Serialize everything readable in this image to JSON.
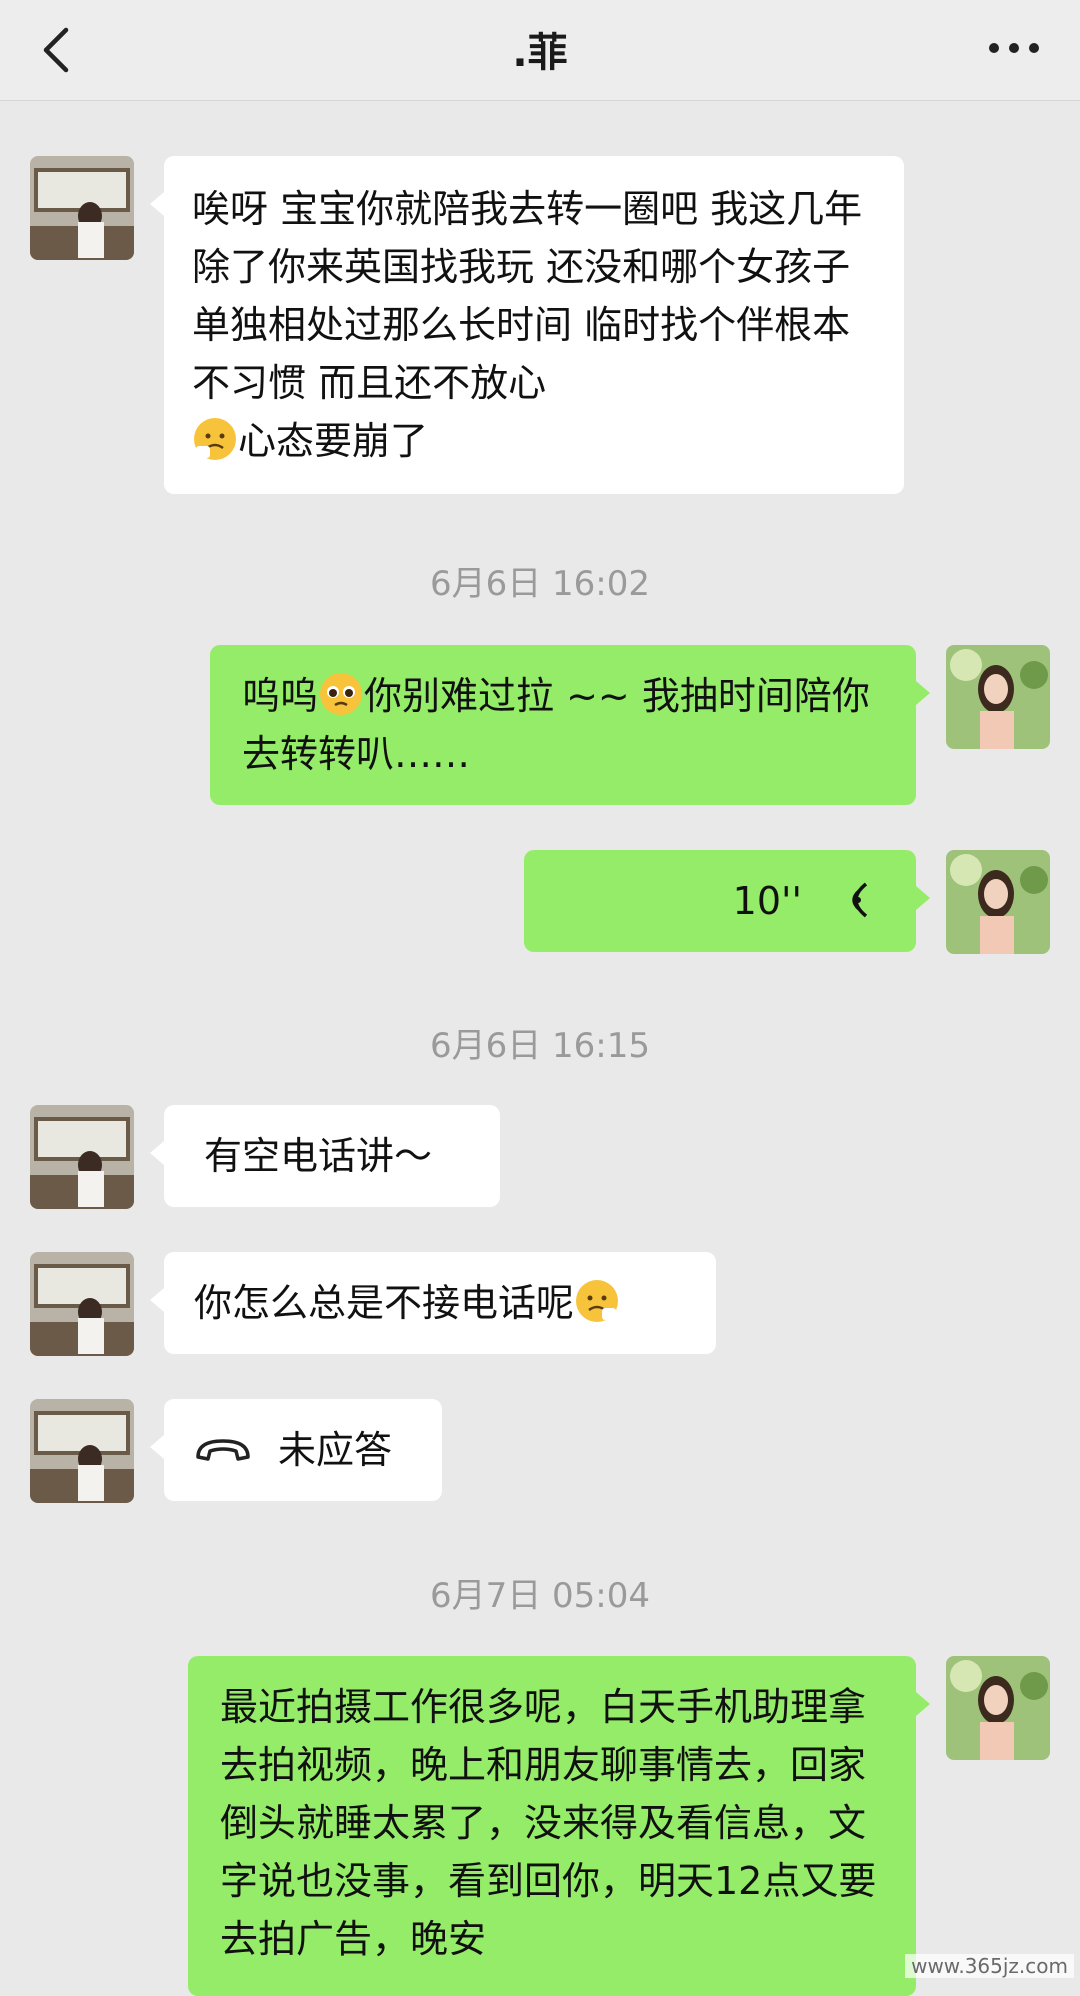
{
  "header": {
    "title": ".菲"
  },
  "messages": {
    "m1": "唉呀 宝宝你就陪我去转一圈吧 我这几年除了你来英国找我玩 还没和哪个女孩子单独相处过那么长时间 临时找个伴根本不习惯 而且还不放心",
    "m1_tail": "心态要崩了",
    "t1": "6月6日 16:02",
    "m2a": "呜呜",
    "m2b": "你别难过拉 ~~ 我抽时间陪你去转转叭……",
    "voice_duration": "10''",
    "t2": "6月6日 16:15",
    "m3": "有空电话讲～",
    "m4": "你怎么总是不接电话呢",
    "call_status": "未应答",
    "t3": "6月7日 05:04",
    "m5": "最近拍摄工作很多呢，白天手机助理拿去拍视频，晚上和朋友聊事情去，回家倒头就睡太累了，没来得及看信息，文字说也没事，看到回你，明天12点又要去拍广告，晚安"
  },
  "watermark": "www.365jz.com",
  "colors": {
    "green_bubble": "#95ec69",
    "white_bubble": "#ffffff",
    "background": "#e9e9e9"
  },
  "icons": [
    "back-arrow-icon",
    "more-dots-icon",
    "sad-face-icon",
    "pleading-face-icon",
    "voice-wave-icon",
    "phone-hangup-icon"
  ]
}
